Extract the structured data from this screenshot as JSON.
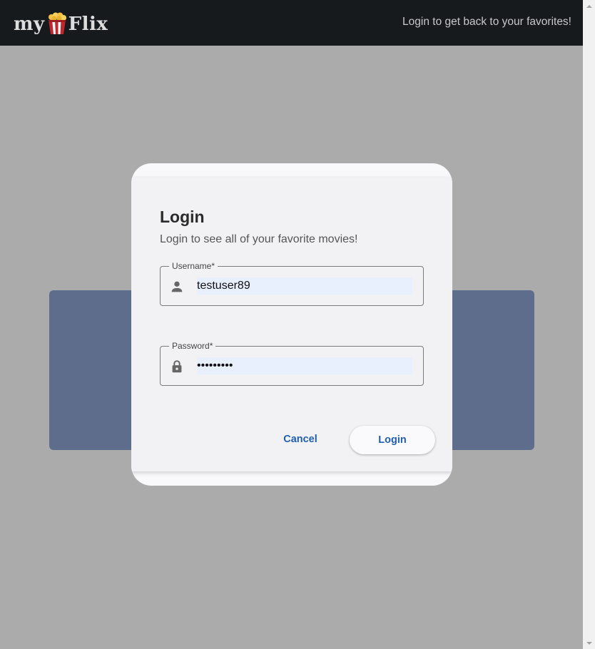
{
  "navbar": {
    "logo_left": "my",
    "logo_right": "Flix",
    "tagline": "Login to get back to your favorites!"
  },
  "dialog": {
    "title": "Login",
    "subtitle": "Login to see all of your favorite movies!",
    "username": {
      "label": "Username*",
      "value": "testuser89",
      "icon": "person-icon"
    },
    "password": {
      "label": "Password*",
      "value": "•••••••••",
      "icon": "lock-icon"
    },
    "cancel_label": "Cancel",
    "login_label": "Login"
  },
  "colors": {
    "navbar_bg": "#161a1d",
    "overlay_bg": "#ababab",
    "panel_bg": "#5d6d8b",
    "dialog_bg": "#f2f2f4",
    "accent": "#1f5fad",
    "autofill_bg": "#e8f0fe"
  }
}
